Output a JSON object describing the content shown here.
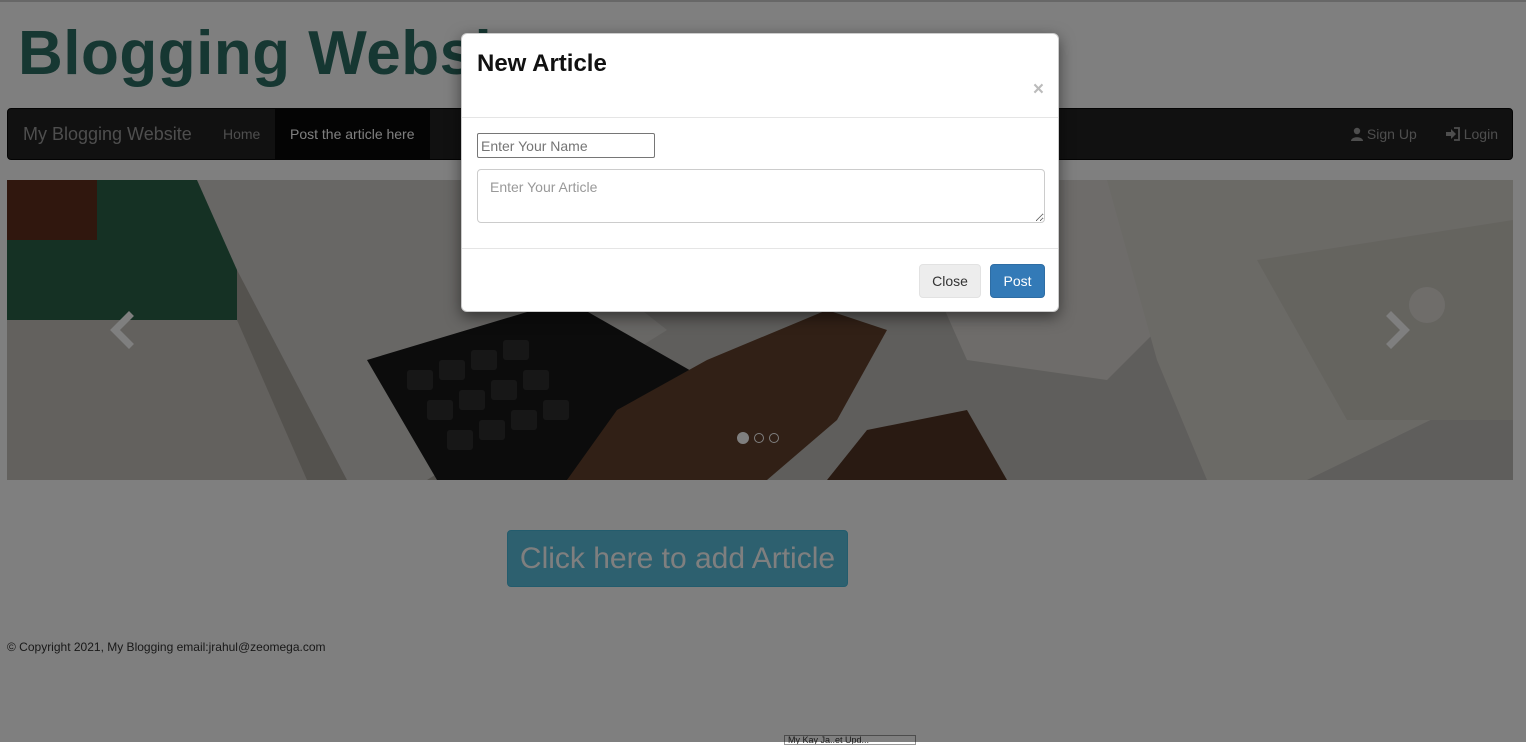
{
  "site": {
    "title": "Blogging Website"
  },
  "navbar": {
    "brand": "My Blogging Website",
    "home": "Home",
    "post_article": "Post the article here",
    "sign_up": "Sign Up",
    "login": "Login"
  },
  "carousel": {
    "slide_count": 3,
    "active_slide": 1
  },
  "main": {
    "add_article_button": "Click here to add Article"
  },
  "footer": {
    "text": "© Copyright 2021, My Blogging email:jrahul@zeomega.com"
  },
  "bottom_tab": {
    "text": "My Kay Ja..et Upd..."
  },
  "modal": {
    "title": "New Article",
    "close_symbol": "×",
    "name_placeholder": "Enter Your Name",
    "article_placeholder": "Enter Your Article",
    "close_button": "Close",
    "post_button": "Post"
  },
  "colors": {
    "title": "#2d6e65",
    "navbar_bg": "#222222",
    "info_button": "#5bc0de",
    "primary_button": "#337ab7"
  }
}
